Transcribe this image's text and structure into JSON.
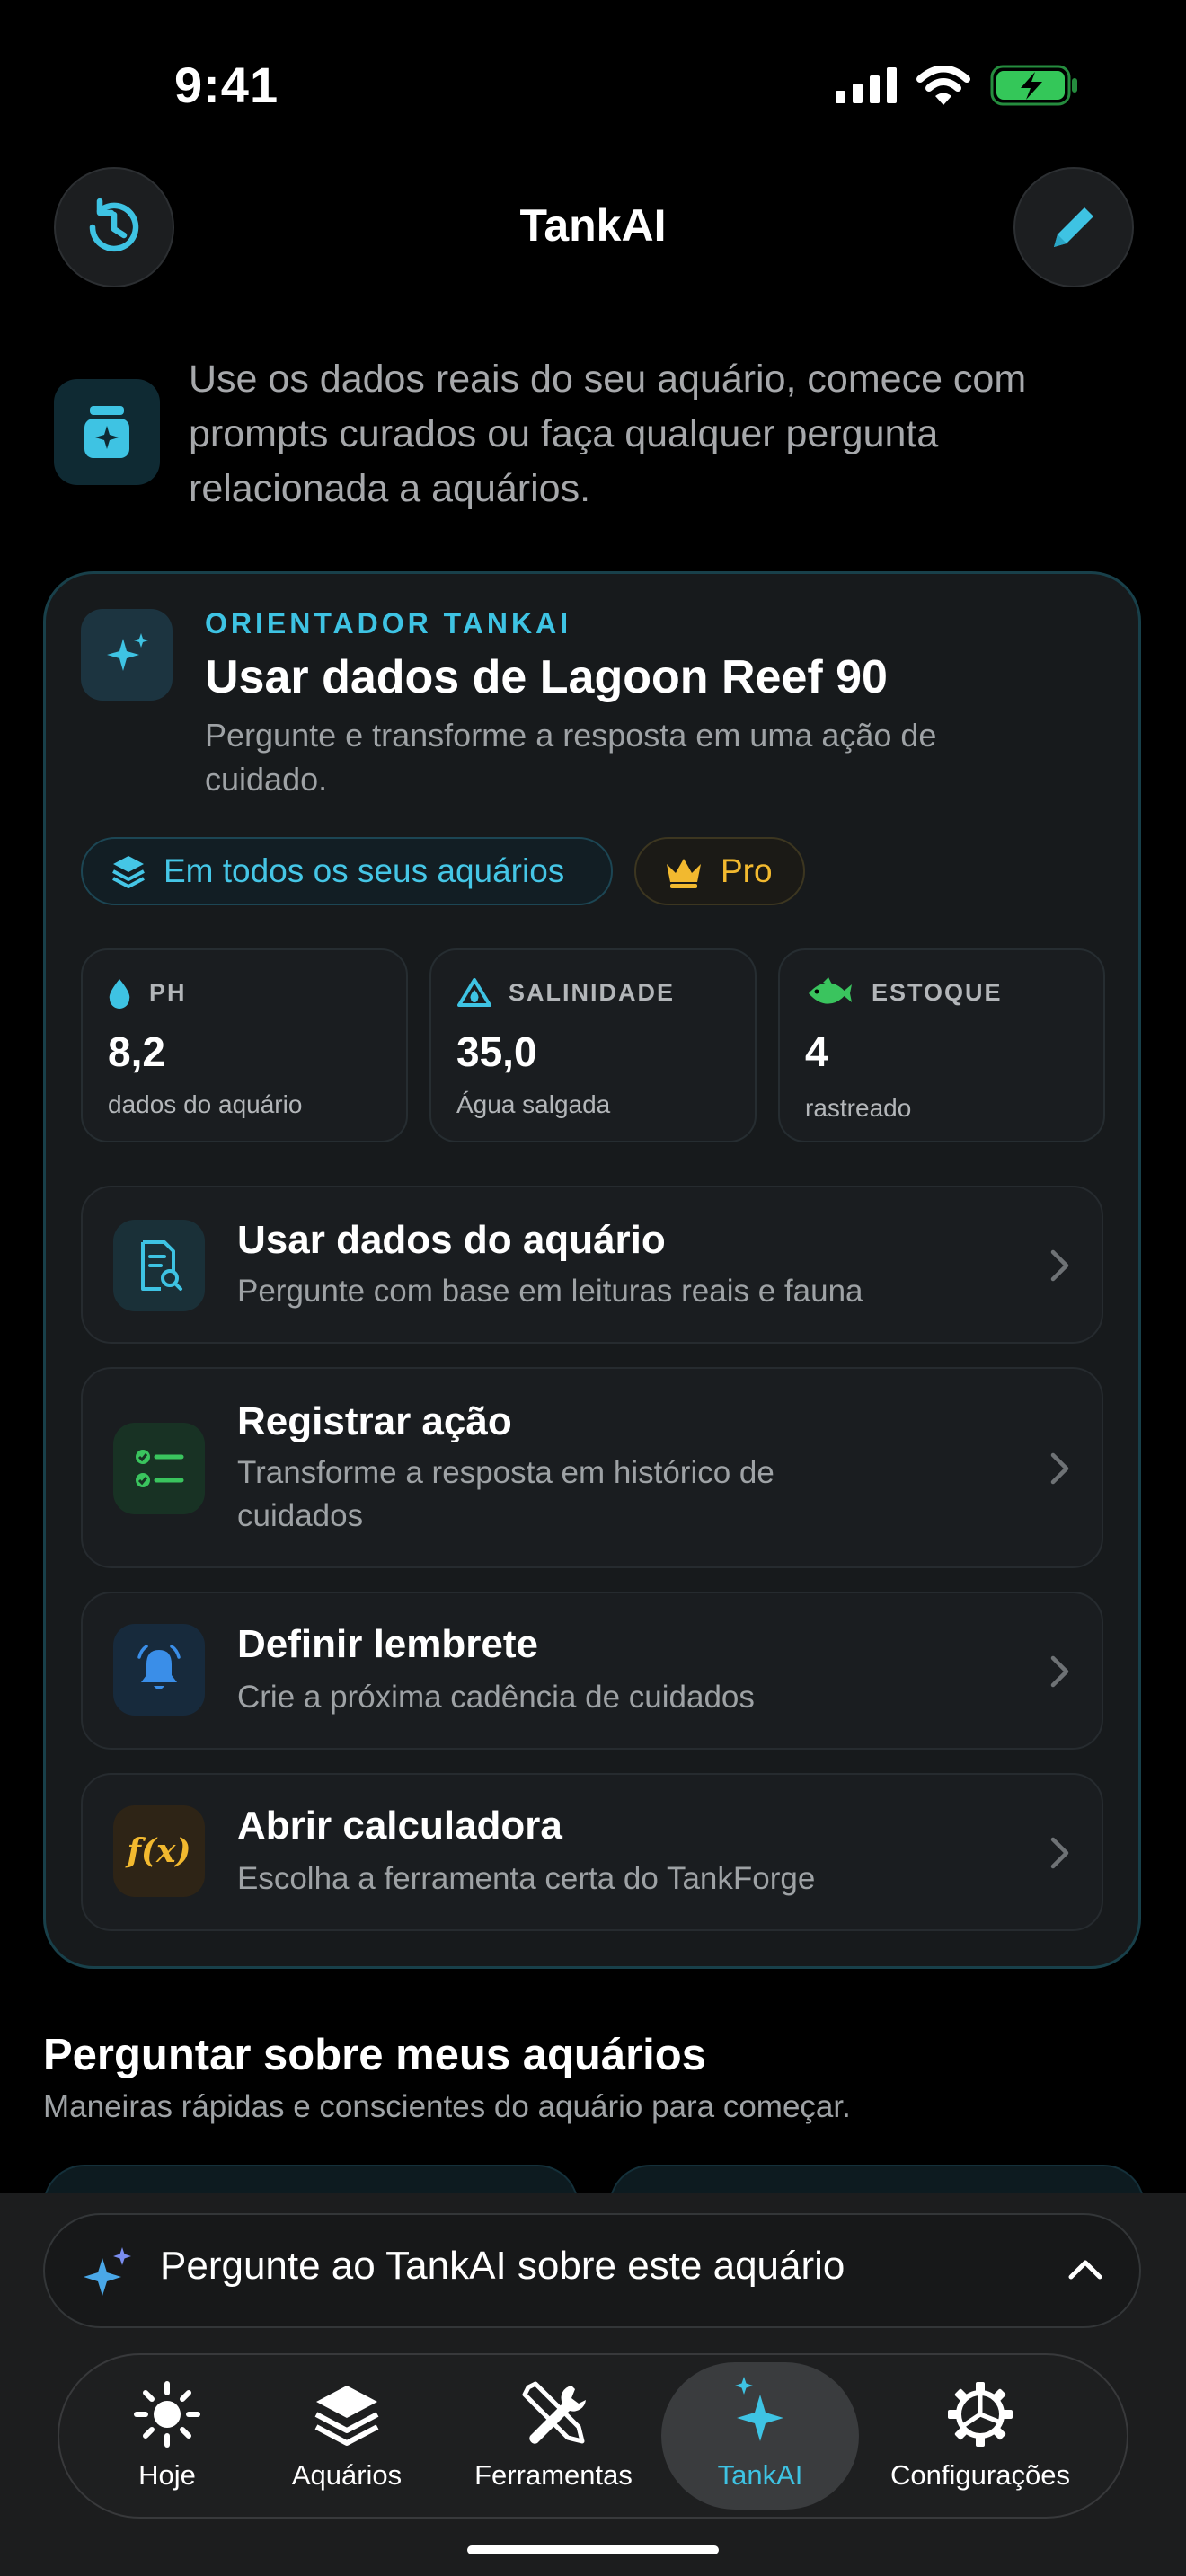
{
  "status_bar": {
    "time": "9:41"
  },
  "header": {
    "title": "TankAI"
  },
  "intro": {
    "text": "Use os dados reais do seu aquário, comece com prompts curados ou faça qualquer pergunta relacionada a aquários."
  },
  "advisor": {
    "eyebrow": "ORIENTADOR TANKAI",
    "title": "Usar dados de Lagoon Reef 90",
    "subtitle": "Pergunte e transforme a resposta em uma ação de cuidado.",
    "scope_chip": "Em todos os seus aquários",
    "pro_chip": "Pro",
    "stats": [
      {
        "label": "PH",
        "value": "8,2",
        "note": "dados do aquário",
        "icon": "water-drop-icon"
      },
      {
        "label": "SALINIDADE",
        "value": "35,0",
        "note": "Água salgada",
        "icon": "salinity-triangle-icon"
      },
      {
        "label": "ESTOQUE",
        "value": "4",
        "note": "rastreado",
        "icon": "fish-icon"
      }
    ],
    "actions": [
      {
        "title": "Usar dados do aquário",
        "subtitle": "Pergunte com base em leituras reais e fauna",
        "icon": "document-search-icon"
      },
      {
        "title": "Registrar ação",
        "subtitle": "Transforme a resposta em histórico de cuidados",
        "icon": "checklist-icon"
      },
      {
        "title": "Definir lembrete",
        "subtitle": "Crie a próxima cadência de cuidados",
        "icon": "bell-icon"
      },
      {
        "title": "Abrir calculadora",
        "subtitle": "Escolha a ferramenta certa do TankForge",
        "icon": "function-icon",
        "icon_text": "f(x)"
      }
    ]
  },
  "section": {
    "title": "Perguntar sobre meus aquários",
    "subtitle": "Maneiras rápidas e conscientes do aquário para começar."
  },
  "ask_bar": {
    "text": "Pergunte ao TankAI sobre este aquário"
  },
  "tabs": [
    {
      "label": "Hoje",
      "icon": "sun-icon"
    },
    {
      "label": "Aquários",
      "icon": "layers-icon"
    },
    {
      "label": "Ferramentas",
      "icon": "tools-icon"
    },
    {
      "label": "TankAI",
      "icon": "sparkles-icon",
      "active": true
    },
    {
      "label": "Configurações",
      "icon": "gear-icon"
    }
  ],
  "colors": {
    "accent": "#3ec3e3",
    "pro": "#f2b92f",
    "green": "#3ac45e",
    "background": "#000000",
    "card": "#171a1c"
  }
}
